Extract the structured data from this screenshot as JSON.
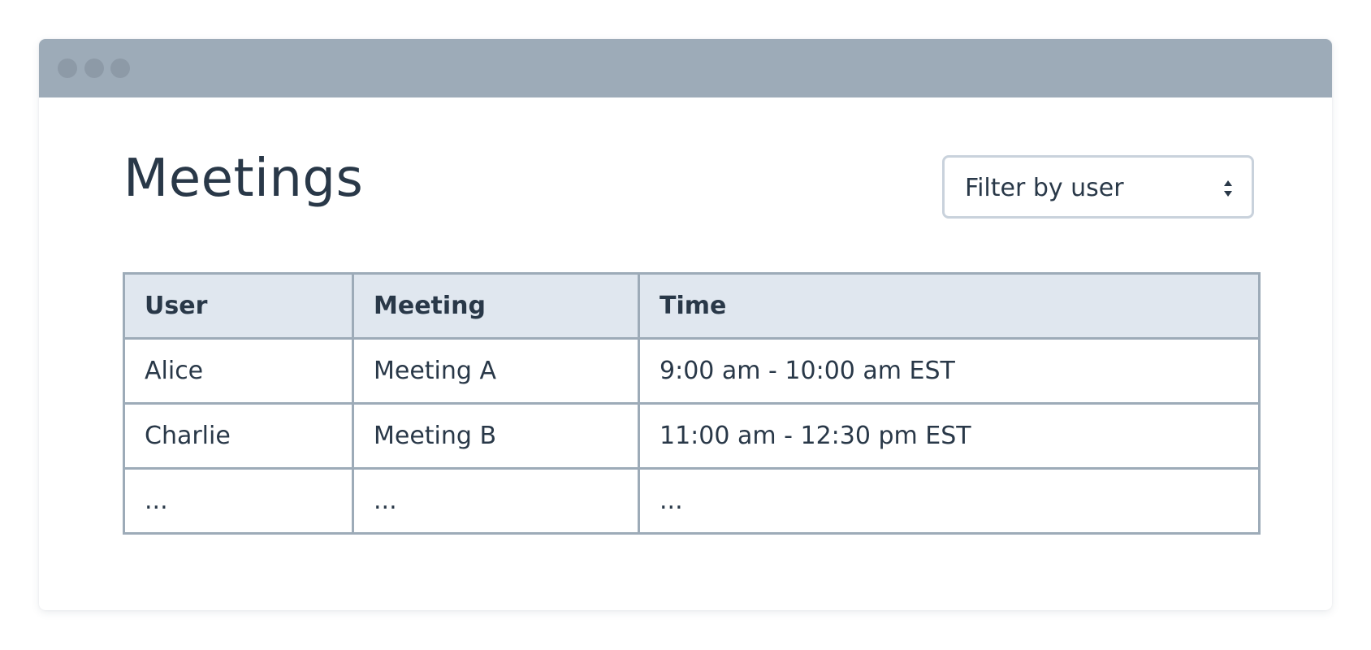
{
  "window": {
    "controls": [
      "window-dot",
      "window-dot",
      "window-dot"
    ]
  },
  "page": {
    "title": "Meetings"
  },
  "filter": {
    "label": "Filter by user",
    "icon": "updown-chevron-icon"
  },
  "table": {
    "headers": [
      "User",
      "Meeting",
      "Time"
    ],
    "rows": [
      [
        "Alice",
        "Meeting A",
        "9:00 am - 10:00 am EST"
      ],
      [
        "Charlie",
        "Meeting B",
        "11:00 am - 12:30 pm EST"
      ],
      [
        "...",
        "...",
        "..."
      ]
    ]
  },
  "colors": {
    "titlebar": "#9dabb8",
    "text": "#293848",
    "table_border": "#9dabb8",
    "header_bg": "#e0e7ef",
    "select_border": "#c9d2dc"
  }
}
